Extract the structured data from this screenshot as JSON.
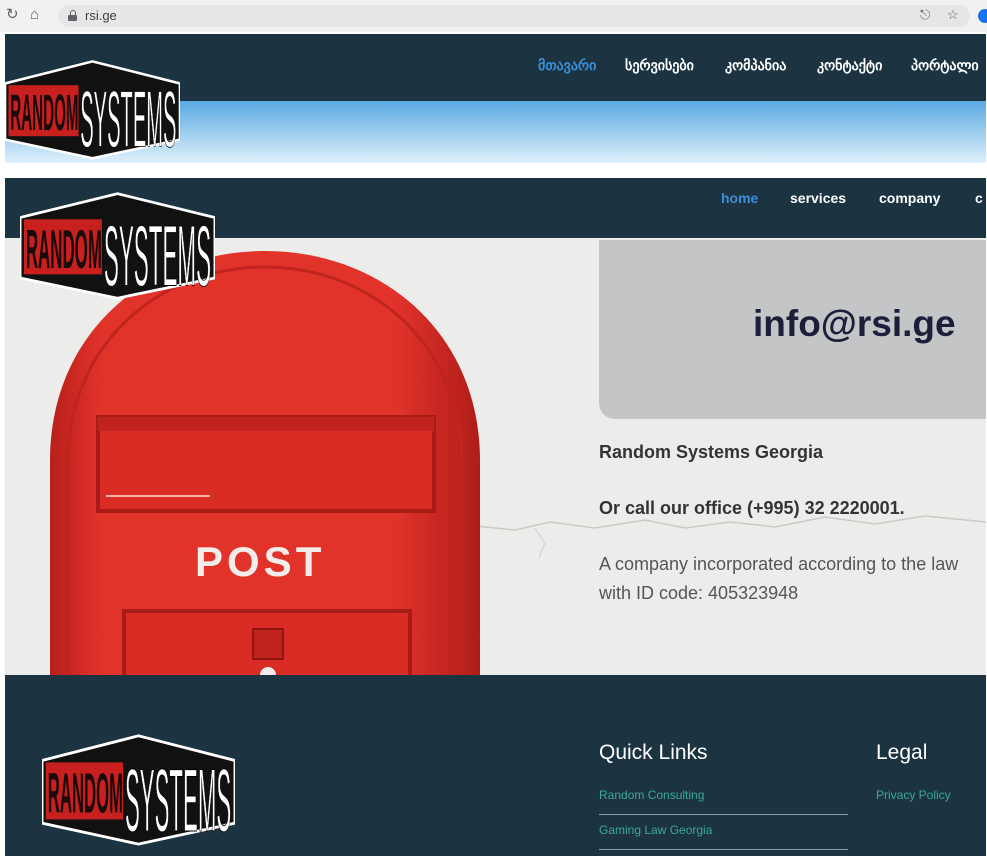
{
  "browser": {
    "url": "rsi.ge",
    "icons": [
      "reload-icon",
      "home-icon",
      "lock-icon",
      "share-icon",
      "bookmark-star-icon",
      "profile-icon"
    ]
  },
  "logo": {
    "line1": "RANDOM",
    "line2": "SYSTEMS"
  },
  "nav_georgian": {
    "items": [
      "მთავარი",
      "სერვისები",
      "კომპანია",
      "კონტაქტი",
      "პორტალი"
    ],
    "active_index": 0
  },
  "nav_english": {
    "items": [
      "home",
      "services",
      "company",
      "c"
    ],
    "active_index": 0
  },
  "hero": {
    "mailbox_label": "POST",
    "email": "info@rsi.ge",
    "company_name": "Random Systems Georgia",
    "phone_line": "Or call our office (+995) 32 2220001.",
    "description_line1": "A company incorporated according to the law",
    "description_line2": "with ID code: 405323948"
  },
  "footer": {
    "quick_links_heading": "Quick Links",
    "quick_links": [
      "Random Consulting",
      "Gaming Law Georgia"
    ],
    "legal_heading": "Legal",
    "legal_links": [
      "Privacy Policy"
    ]
  },
  "colors": {
    "header_bg": "#1c3442",
    "nav_active": "#3b8fd8",
    "footer_link": "#3aa89a",
    "email_panel": "#c4c5c6",
    "mailbox_red": "#e2332b",
    "logo_red": "#c8201e"
  }
}
